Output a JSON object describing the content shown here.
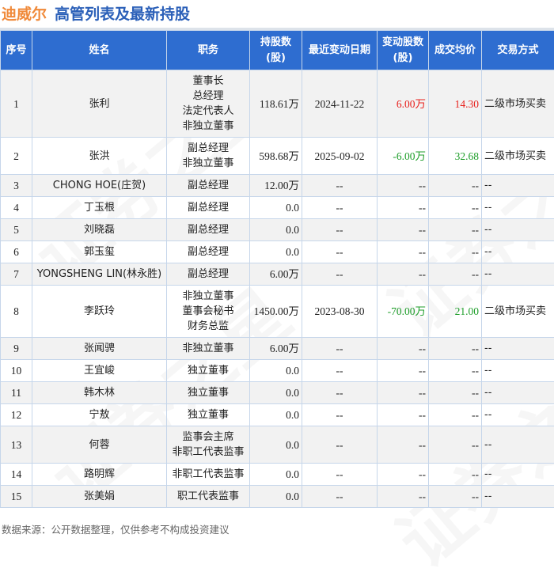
{
  "title": {
    "company": "迪威尔",
    "subtitle": "高管列表及最新持股"
  },
  "columns": [
    "序号",
    "姓名",
    "职务",
    "持股数\n(股)",
    "最近变动日期",
    "变动股数\n(股)",
    "成交均价",
    "交易方式"
  ],
  "rows": [
    {
      "no": "1",
      "name": "张利",
      "roles": [
        "董事长",
        "总经理",
        "法定代表人",
        "非独立董事"
      ],
      "shares": "118.61万",
      "date": "2024-11-22",
      "change": "6.00万",
      "price": "14.30",
      "method": "二级市场买卖",
      "trend": "up"
    },
    {
      "no": "2",
      "name": "张洪",
      "roles": [
        "副总经理",
        "非独立董事"
      ],
      "shares": "598.68万",
      "date": "2025-09-02",
      "change": "-6.00万",
      "price": "32.68",
      "method": "二级市场买卖",
      "trend": "down"
    },
    {
      "no": "3",
      "name": "CHONG HOE(庄贺)",
      "roles": [
        "副总经理"
      ],
      "shares": "12.00万",
      "date": "--",
      "change": "--",
      "price": "--",
      "method": "--",
      "trend": ""
    },
    {
      "no": "4",
      "name": "丁玉根",
      "roles": [
        "副总经理"
      ],
      "shares": "0.0",
      "date": "--",
      "change": "--",
      "price": "--",
      "method": "--",
      "trend": ""
    },
    {
      "no": "5",
      "name": "刘晓磊",
      "roles": [
        "副总经理"
      ],
      "shares": "0.0",
      "date": "--",
      "change": "--",
      "price": "--",
      "method": "--",
      "trend": ""
    },
    {
      "no": "6",
      "name": "郭玉玺",
      "roles": [
        "副总经理"
      ],
      "shares": "0.0",
      "date": "--",
      "change": "--",
      "price": "--",
      "method": "--",
      "trend": ""
    },
    {
      "no": "7",
      "name": "YONGSHENG LIN(林永胜)",
      "roles": [
        "副总经理"
      ],
      "shares": "6.00万",
      "date": "--",
      "change": "--",
      "price": "--",
      "method": "--",
      "trend": ""
    },
    {
      "no": "8",
      "name": "李跃玲",
      "roles": [
        "非独立董事",
        "董事会秘书",
        "财务总监"
      ],
      "shares": "1450.00万",
      "date": "2023-08-30",
      "change": "-70.00万",
      "price": "21.00",
      "method": "二级市场买卖",
      "trend": "down"
    },
    {
      "no": "9",
      "name": "张闻骋",
      "roles": [
        "非独立董事"
      ],
      "shares": "6.00万",
      "date": "--",
      "change": "--",
      "price": "--",
      "method": "--",
      "trend": ""
    },
    {
      "no": "10",
      "name": "王宜峻",
      "roles": [
        "独立董事"
      ],
      "shares": "0.0",
      "date": "--",
      "change": "--",
      "price": "--",
      "method": "--",
      "trend": ""
    },
    {
      "no": "11",
      "name": "韩木林",
      "roles": [
        "独立董事"
      ],
      "shares": "0.0",
      "date": "--",
      "change": "--",
      "price": "--",
      "method": "--",
      "trend": ""
    },
    {
      "no": "12",
      "name": "宁敖",
      "roles": [
        "独立董事"
      ],
      "shares": "0.0",
      "date": "--",
      "change": "--",
      "price": "--",
      "method": "--",
      "trend": ""
    },
    {
      "no": "13",
      "name": "何蓉",
      "roles": [
        "监事会主席",
        "非职工代表监事"
      ],
      "shares": "0.0",
      "date": "--",
      "change": "--",
      "price": "--",
      "method": "--",
      "trend": ""
    },
    {
      "no": "14",
      "name": "路明辉",
      "roles": [
        "非职工代表监事"
      ],
      "shares": "0.0",
      "date": "--",
      "change": "--",
      "price": "--",
      "method": "--",
      "trend": ""
    },
    {
      "no": "15",
      "name": "张美娟",
      "roles": [
        "职工代表监事"
      ],
      "shares": "0.0",
      "date": "--",
      "change": "--",
      "price": "--",
      "method": "--",
      "trend": ""
    }
  ],
  "footer": "数据来源：公开数据整理，仅供参考不构成投资建议",
  "colors": {
    "header": "#2e6dd0",
    "up": "#e8201c",
    "down": "#1e9e2a",
    "company": "#f08a3a"
  }
}
